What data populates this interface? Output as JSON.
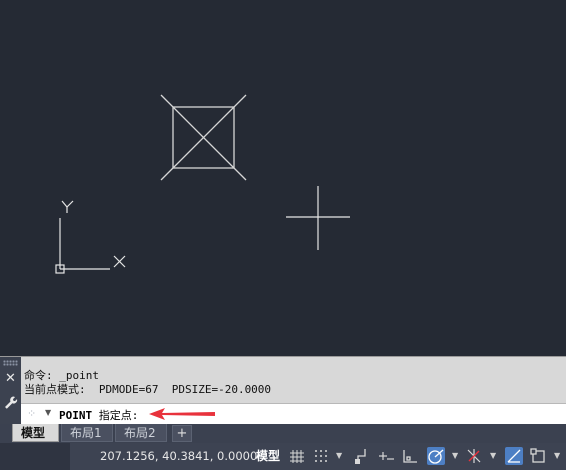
{
  "canvas": {
    "background": "#252a34",
    "ucs": {
      "x_label": "X",
      "y_label": "Y"
    }
  },
  "command_line": {
    "history": [
      "命令: _point",
      "当前点模式:  PDMODE=67  PDSIZE=-20.0000"
    ],
    "prompt_command": "POINT",
    "prompt_text": " 指定点:"
  },
  "tabs": [
    {
      "label": "模型",
      "active": true
    },
    {
      "label": "布局1",
      "active": false
    },
    {
      "label": "布局2",
      "active": false
    }
  ],
  "tab_add_label": "+",
  "status_bar": {
    "coordinates": "207.1256, 40.3841, 0.0000",
    "model_label": "模型",
    "icons": [
      "grid-icon",
      "snap-icon",
      "infer-icon",
      "dynamic-input-icon",
      "ortho-icon",
      "polar-icon",
      "isodraft-icon",
      "object-snap-tracking-icon",
      "object-snap-icon"
    ]
  },
  "colors": {
    "accent_blue": "#4d7fc4",
    "arrow_red": "#e8323c"
  }
}
